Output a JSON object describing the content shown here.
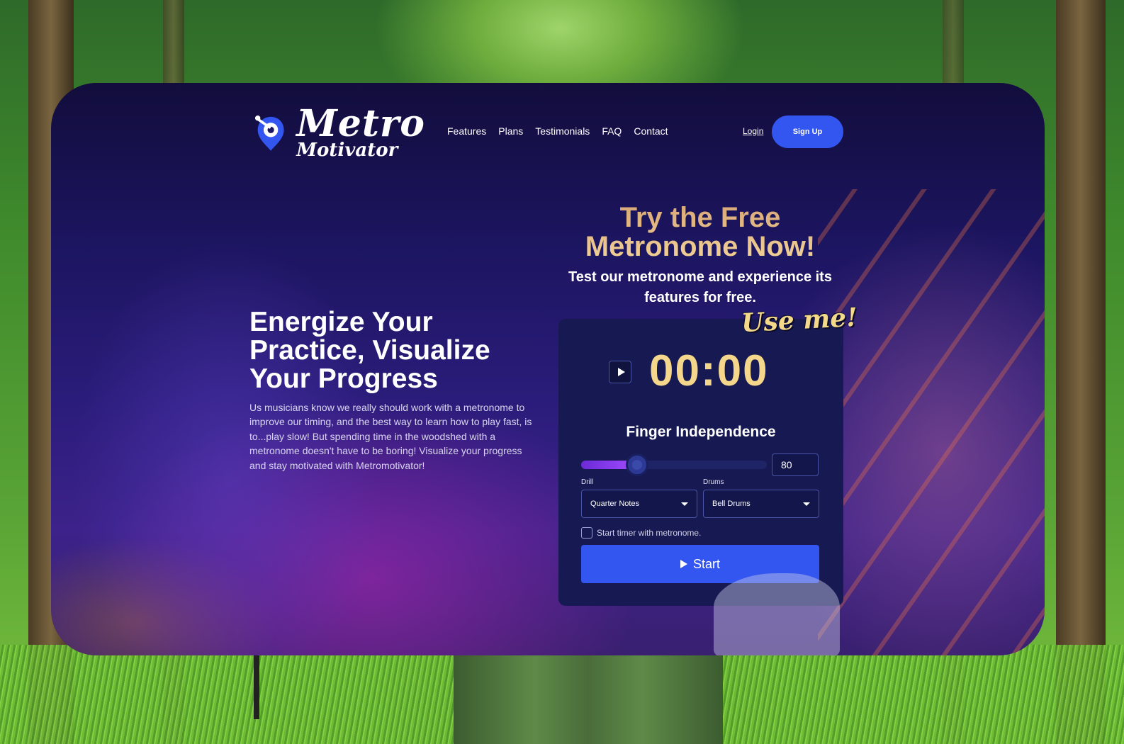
{
  "brand": {
    "name_line1": "Metro",
    "name_line2": "Motivator"
  },
  "nav": {
    "items": [
      "Features",
      "Plans",
      "Testimonials",
      "FAQ",
      "Contact"
    ],
    "login": "Login",
    "signup": "Sign Up"
  },
  "hero": {
    "title": "Energize Your Practice, Visualize Your Progress",
    "body": "Us musicians know we really should work with a metronome to improve our timing, and the best way to learn how to play fast, is to...play slow! But spending time in the woodshed with a metronome doesn't have to be boring! Visualize your progress and stay motivated with Metromotivator!"
  },
  "trial": {
    "title": "Try the Free Metronome Now!",
    "subtitle": "Test our metronome and experience its features for free.",
    "badge": "Use me!"
  },
  "widget": {
    "timer": "00:00",
    "exercise": "Finger Independence",
    "bpm": "80",
    "slider_fraction": 0.24,
    "drill_label": "Drill",
    "drill_value": "Quarter Notes",
    "drums_label": "Drums",
    "drums_value": "Bell Drums",
    "timer_checkbox_label": "Start timer with metronome.",
    "timer_checkbox_checked": false,
    "start_label": "Start"
  },
  "colors": {
    "accent": "#3356f0",
    "timer": "#f5d78c",
    "panel": "#171a52",
    "card": "#1c1560"
  }
}
